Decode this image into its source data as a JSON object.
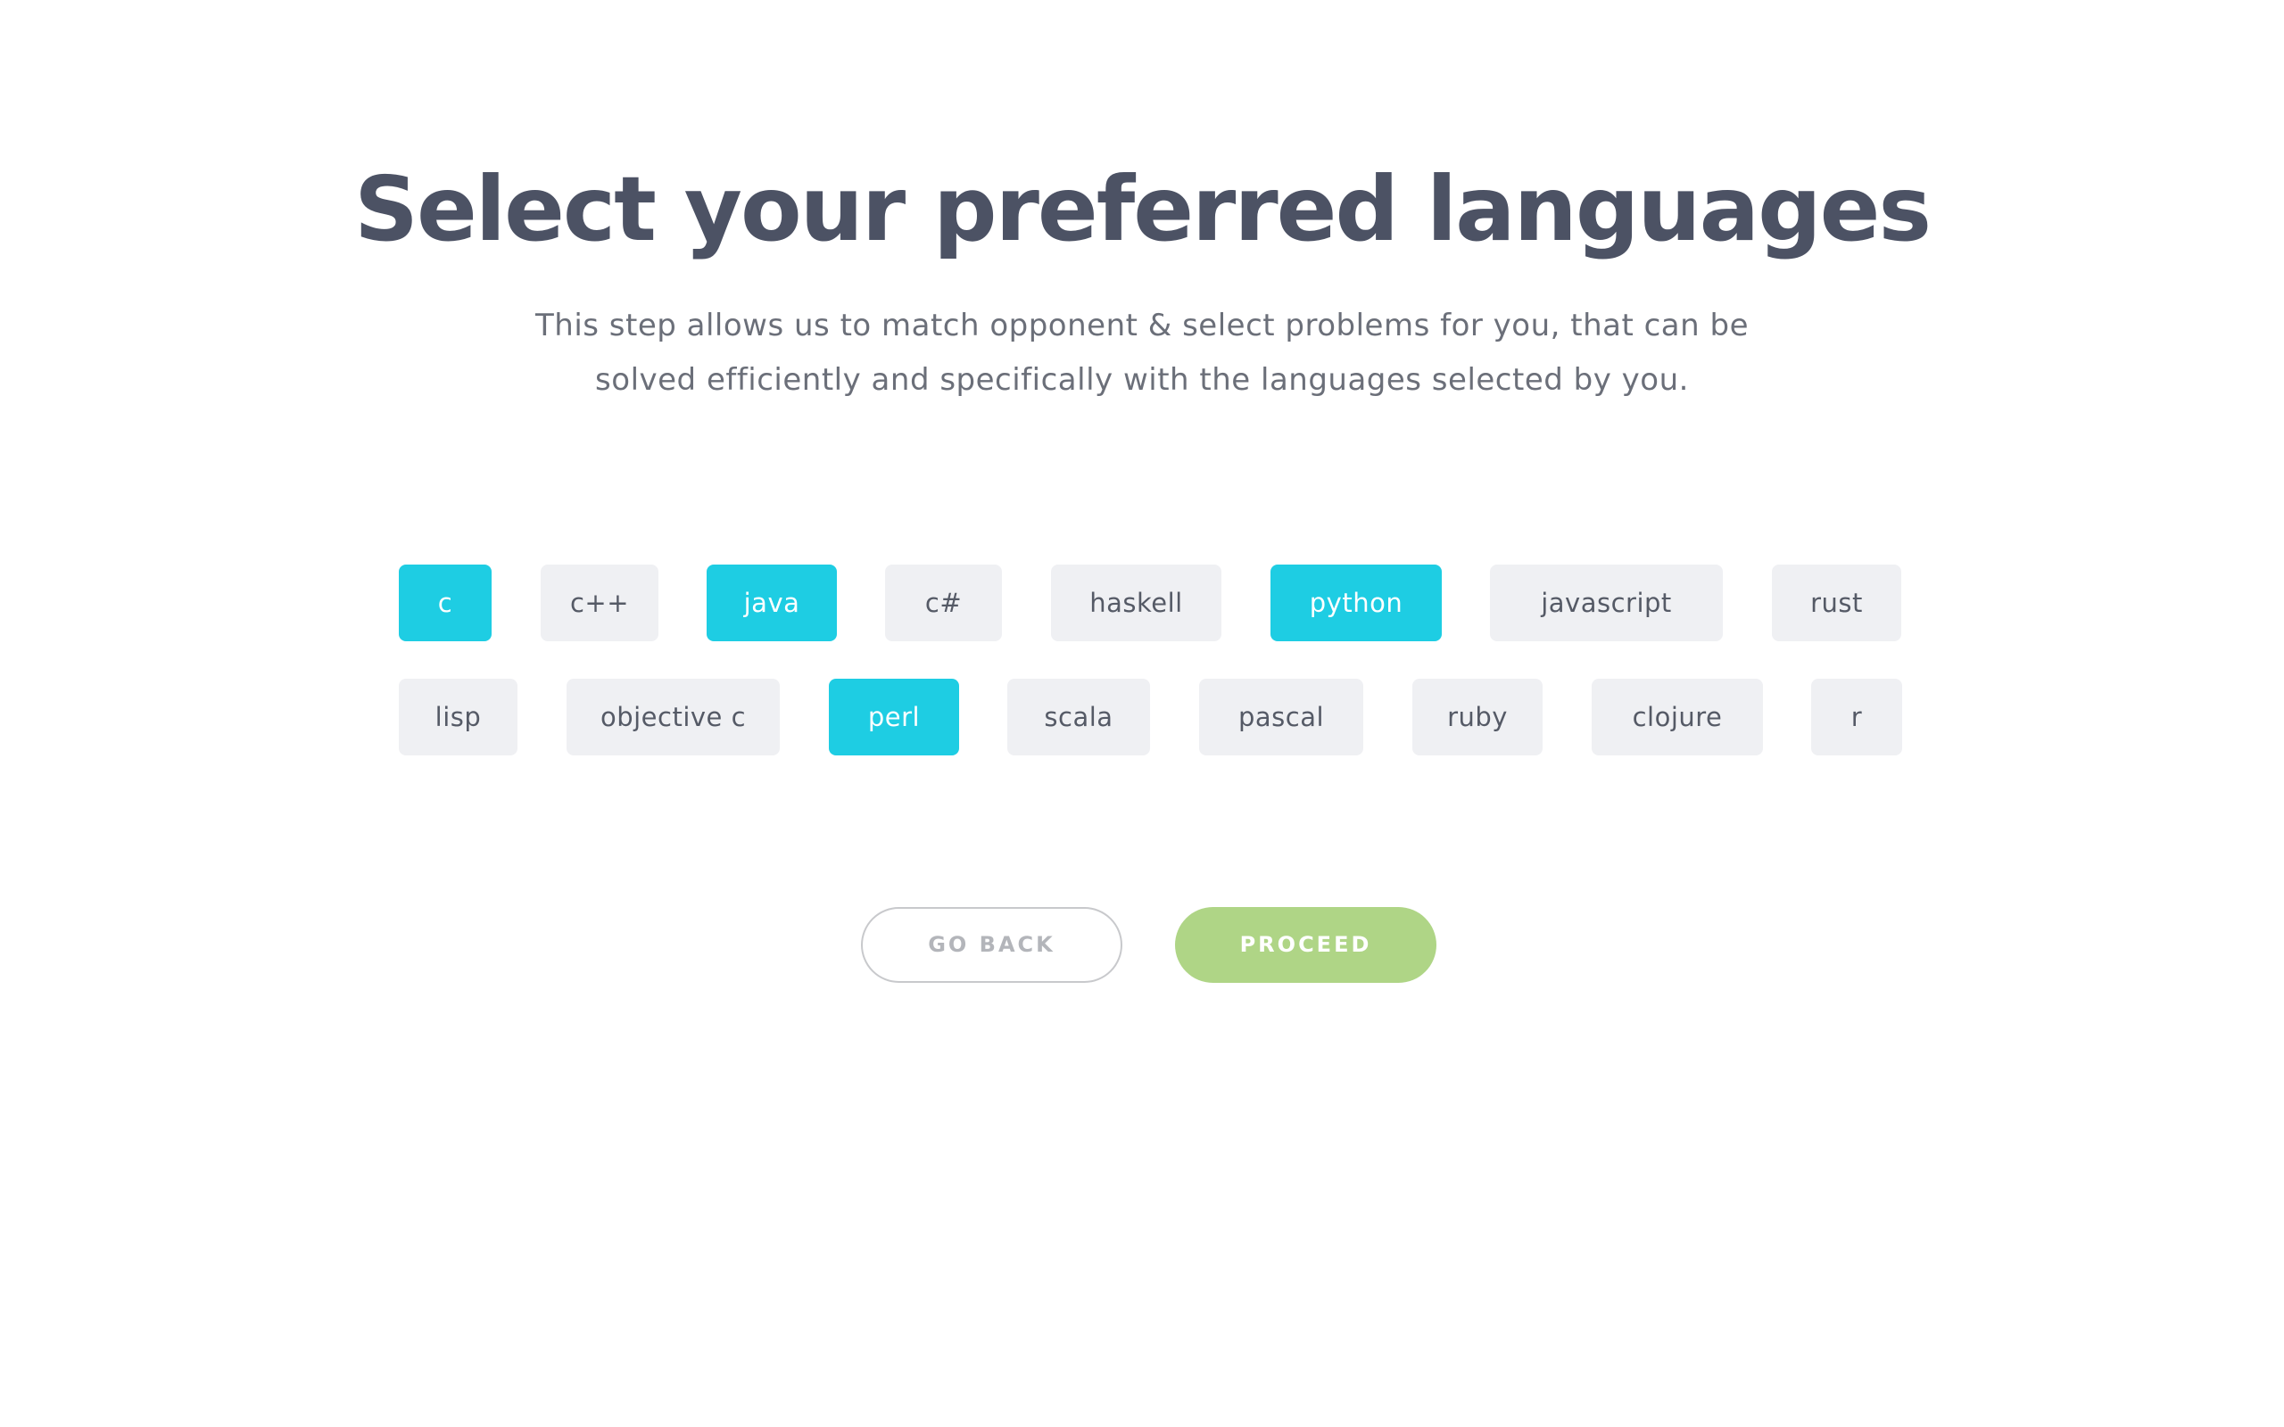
{
  "header": {
    "title": "Select your preferred languages",
    "subtitle_line1": "This step allows us to match opponent & select problems for you, that can be",
    "subtitle_line2": "solved efficiently and specifically with the languages selected by you."
  },
  "languages": {
    "row1": [
      {
        "label": "c",
        "selected": true
      },
      {
        "label": "c++",
        "selected": false
      },
      {
        "label": "java",
        "selected": true
      },
      {
        "label": "c#",
        "selected": false
      },
      {
        "label": "haskell",
        "selected": false
      },
      {
        "label": "python",
        "selected": true
      },
      {
        "label": "javascript",
        "selected": false
      },
      {
        "label": "rust",
        "selected": false
      }
    ],
    "row2": [
      {
        "label": "lisp",
        "selected": false
      },
      {
        "label": "objective c",
        "selected": false
      },
      {
        "label": "perl",
        "selected": true
      },
      {
        "label": "scala",
        "selected": false
      },
      {
        "label": "pascal",
        "selected": false
      },
      {
        "label": "ruby",
        "selected": false
      },
      {
        "label": "clojure",
        "selected": false
      },
      {
        "label": "r",
        "selected": false
      }
    ]
  },
  "actions": {
    "back_label": "GO BACK",
    "proceed_label": "PROCEED"
  },
  "colors": {
    "selected": "#1ecde3",
    "unselected": "#eff0f3",
    "proceed": "#afd586",
    "title": "#4c5264"
  }
}
